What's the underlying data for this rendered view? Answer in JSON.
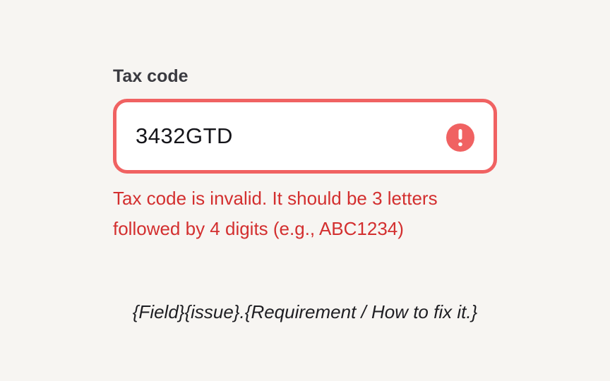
{
  "field": {
    "label": "Tax code",
    "value": "3432GTD",
    "state": "error",
    "icon": "exclamation-circle-icon"
  },
  "error": {
    "message": "Tax code is invalid. It should be 3 letters followed by 4 digits (e.g., ABC1234)"
  },
  "pattern": {
    "text": "{Field}{issue}.{Requirement / How to fix it.}"
  },
  "colors": {
    "background": "#f7f5f2",
    "error_border": "#f06262",
    "error_text": "#d32f2f",
    "error_icon": "#f06262"
  }
}
